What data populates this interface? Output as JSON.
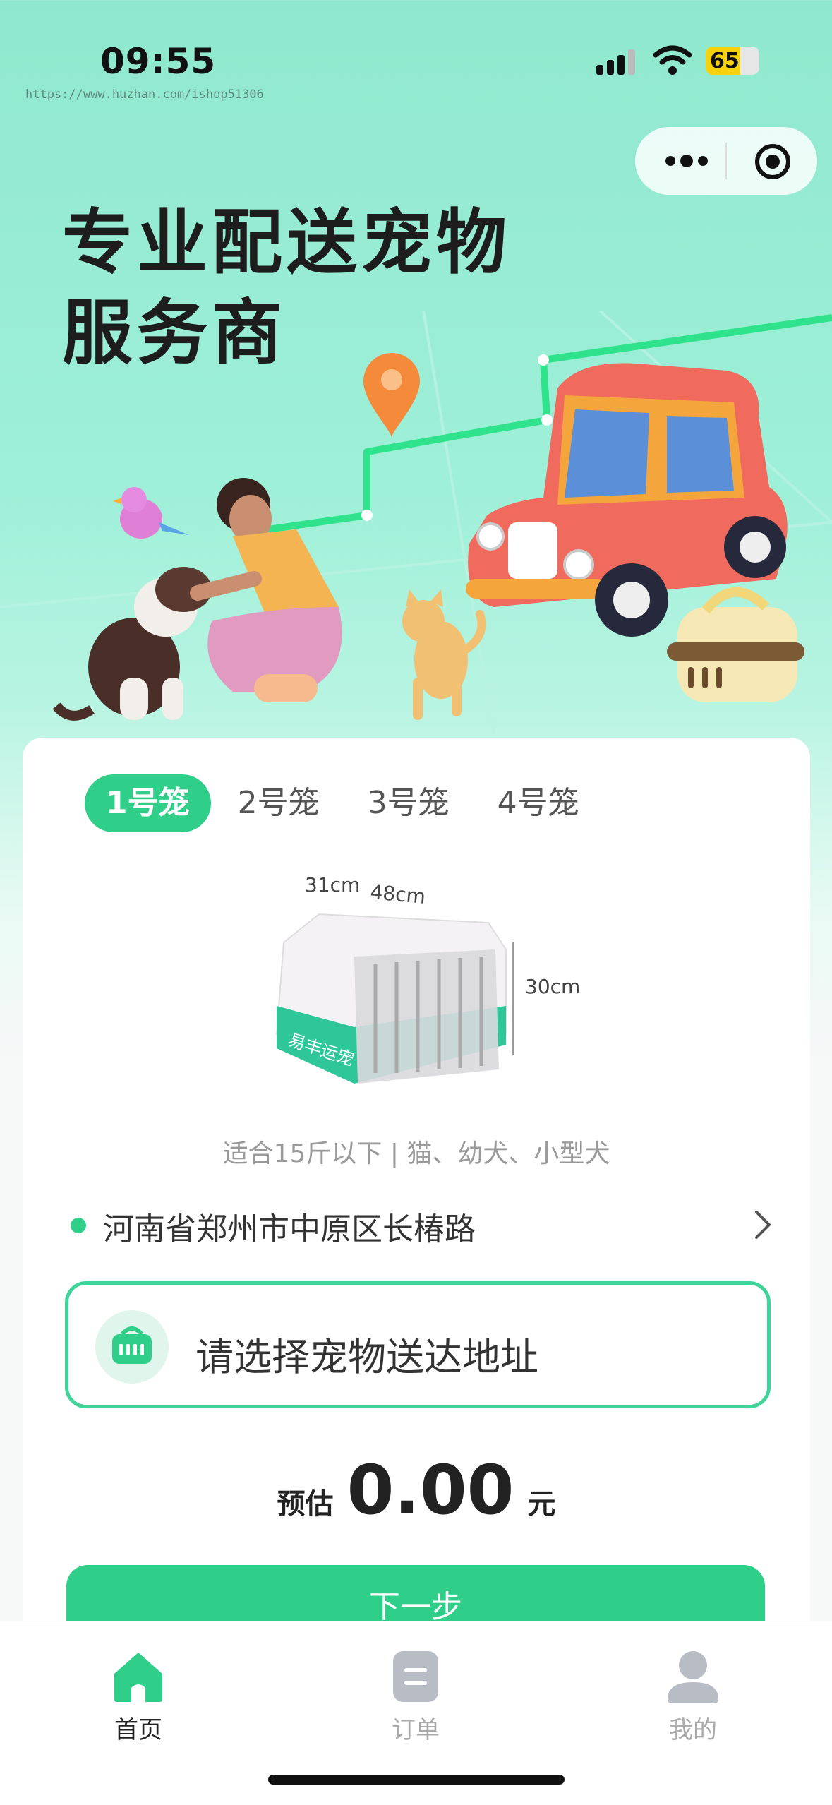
{
  "status_bar": {
    "time": "09:55",
    "battery": "65",
    "battery_level": 0.65
  },
  "watermark": "https://www.huzhan.com/ishop51306",
  "hero": {
    "title_line1": "专业配送宠物",
    "title_line2": "服务商"
  },
  "cage_tabs": [
    {
      "label": "1号笼",
      "active": true
    },
    {
      "label": "2号笼",
      "active": false
    },
    {
      "label": "3号笼",
      "active": false
    },
    {
      "label": "4号笼",
      "active": false
    }
  ],
  "cage": {
    "dim_depth": "31cm",
    "dim_width": "48cm",
    "dim_height": "30cm",
    "brand_text": "易丰运宠",
    "description": "适合15斤以下 | 猫、幼犬、小型犬"
  },
  "origin": {
    "address": "河南省郑州市中原区长椿路"
  },
  "destination": {
    "placeholder": "请选择宠物送达地址"
  },
  "price": {
    "label": "预估",
    "value": "0.00",
    "unit": "元"
  },
  "next_button": "下一步",
  "tabbar": {
    "items": [
      {
        "label": "首页",
        "icon": "home-icon",
        "active": true
      },
      {
        "label": "订单",
        "icon": "order-icon",
        "active": false
      },
      {
        "label": "我的",
        "icon": "profile-icon",
        "active": false
      }
    ]
  },
  "colors": {
    "accent": "#2fcf8a",
    "accent_border": "#3fd49a",
    "hero_bg": "#9ff0d8",
    "car": "#f06a5e"
  }
}
